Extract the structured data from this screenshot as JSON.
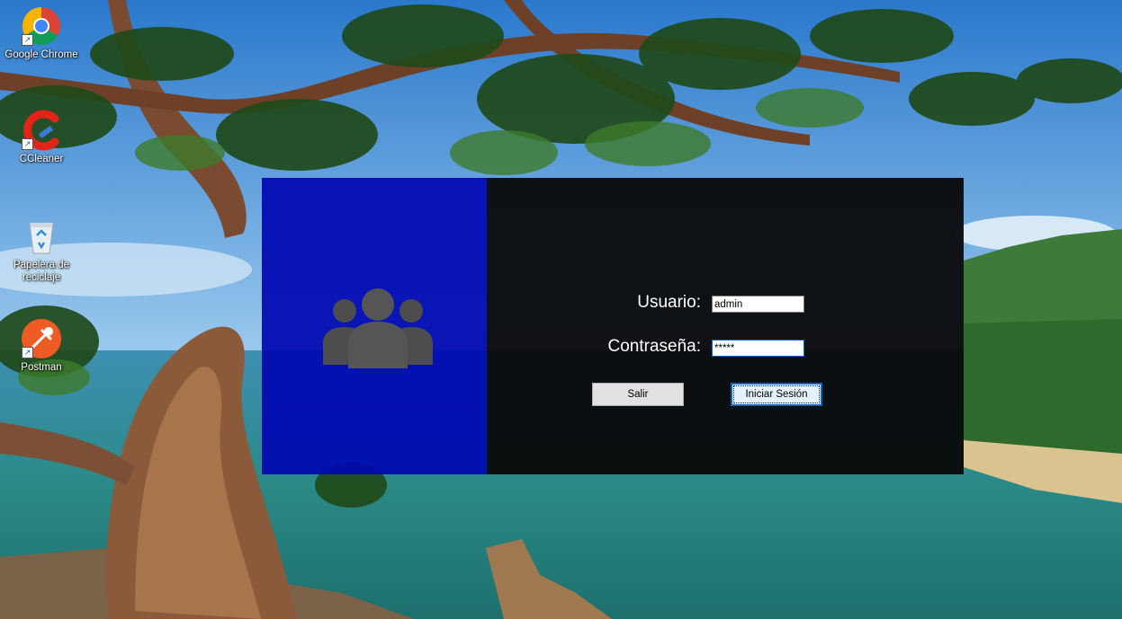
{
  "desktop": {
    "icons": [
      {
        "label": "Google Chrome",
        "icon": "chrome-icon"
      },
      {
        "label": "CCleaner",
        "icon": "ccleaner-icon"
      },
      {
        "label": "Papelera de reciclaje",
        "icon": "recycle-bin-icon"
      },
      {
        "label": "Postman",
        "icon": "postman-icon"
      }
    ]
  },
  "login": {
    "left_icon": "users-group-icon",
    "username_label": "Usuario:",
    "username_value": "admin",
    "password_label": "Contraseña:",
    "password_value": "*****",
    "exit_button": "Salir",
    "login_button": "Iniciar Sesión"
  },
  "colors": {
    "left_panel": "#0008b2",
    "right_panel": "#08080a",
    "focus_blue": "#0a64c8"
  }
}
